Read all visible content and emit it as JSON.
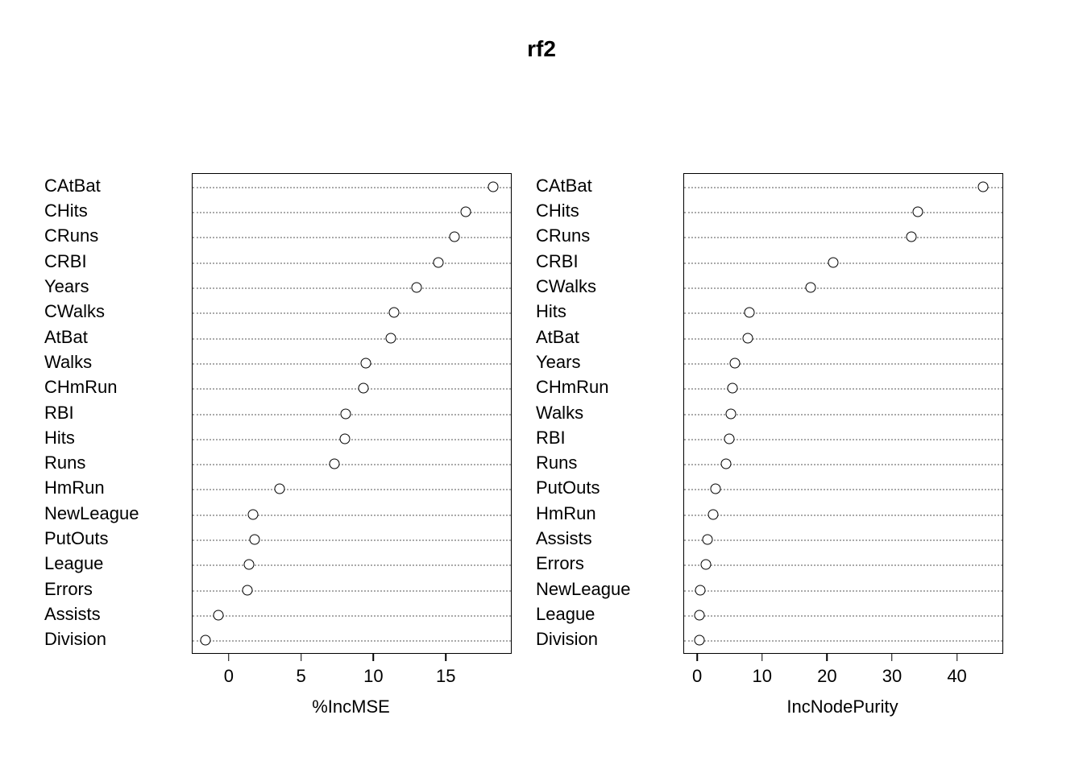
{
  "title": "rf2",
  "chart_data": [
    {
      "type": "dot",
      "xlabel": "%IncMSE",
      "xlim": [
        -2.5,
        19.5
      ],
      "xticks": [
        0,
        5,
        10,
        15
      ],
      "categories": [
        "CAtBat",
        "CHits",
        "CRuns",
        "CRBI",
        "Years",
        "CWalks",
        "AtBat",
        "Walks",
        "CHmRun",
        "RBI",
        "Hits",
        "Runs",
        "HmRun",
        "NewLeague",
        "PutOuts",
        "League",
        "Errors",
        "Assists",
        "Division"
      ],
      "values": [
        18.3,
        16.4,
        15.6,
        14.5,
        13.0,
        11.4,
        11.2,
        9.5,
        9.3,
        8.1,
        8.0,
        7.3,
        3.5,
        1.7,
        1.8,
        1.4,
        1.3,
        -0.7,
        -1.6
      ]
    },
    {
      "type": "dot",
      "xlabel": "IncNodePurity",
      "xlim": [
        -2,
        47
      ],
      "xticks": [
        0,
        10,
        20,
        30,
        40
      ],
      "categories": [
        "CAtBat",
        "CHits",
        "CRuns",
        "CRBI",
        "CWalks",
        "Hits",
        "AtBat",
        "Years",
        "CHmRun",
        "Walks",
        "RBI",
        "Runs",
        "PutOuts",
        "HmRun",
        "Assists",
        "Errors",
        "NewLeague",
        "League",
        "Division"
      ],
      "values": [
        44.0,
        34.0,
        33.0,
        21.0,
        17.5,
        8.0,
        7.8,
        5.8,
        5.4,
        5.2,
        5.0,
        4.4,
        2.8,
        2.5,
        1.6,
        1.4,
        0.5,
        0.4,
        0.3
      ]
    }
  ]
}
